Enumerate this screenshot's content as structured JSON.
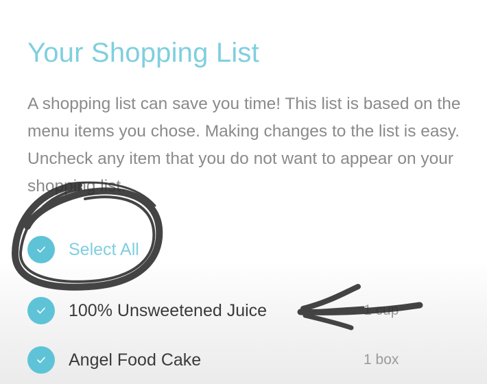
{
  "header": {
    "title": "Your Shopping List"
  },
  "intro": {
    "text": "A shopping list can save you time! This list is based on the menu items you chose. Making changes to the list is easy. Uncheck any item that you do not want to appear on your shopping list."
  },
  "select_all": {
    "label": "Select All",
    "checked": true
  },
  "items": [
    {
      "name": "100% Unsweetened Juice",
      "quantity": "1 cup",
      "checked": true
    },
    {
      "name": "Angel Food Cake",
      "quantity": "1 box",
      "checked": true
    }
  ],
  "colors": {
    "accent": "#7fcfdf",
    "check_fill": "#5fc3d8",
    "body_text": "#8a8a8a",
    "item_text": "#3a3a3a",
    "annotation_ink": "#2b2b2b"
  },
  "icons": {
    "checkbox": "checkmark-icon"
  }
}
